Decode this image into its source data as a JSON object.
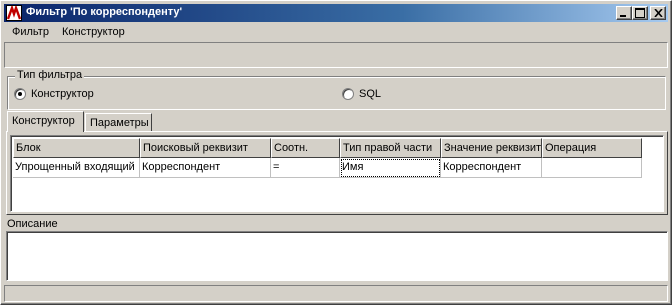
{
  "window": {
    "title": "Фильтр 'По корреспонденту'",
    "icon": "app-red-logo-icon"
  },
  "menu": [
    "Фильтр",
    "Конструктор"
  ],
  "filter_type": {
    "legend": "Тип фильтра",
    "options": [
      {
        "label": "Конструктор",
        "checked": true
      },
      {
        "label": "SQL",
        "checked": false
      }
    ]
  },
  "tabs": [
    {
      "label": "Конструктор",
      "active": true
    },
    {
      "label": "Параметры",
      "active": false
    }
  ],
  "grid": {
    "columns": [
      "Блок",
      "Поисковый реквизит",
      "Соотн.",
      "Тип правой части",
      "Значение реквизит",
      "Операция"
    ],
    "rows": [
      [
        "Упрощенный входящий",
        "Корреспондент",
        "=",
        "Имя",
        "Корреспондент",
        ""
      ]
    ]
  },
  "description": {
    "label": "Описание",
    "value": ""
  },
  "colors": {
    "title_bar_start": "#0a246a",
    "title_bar_end": "#a6caf0",
    "face": "#d4d0c8"
  }
}
